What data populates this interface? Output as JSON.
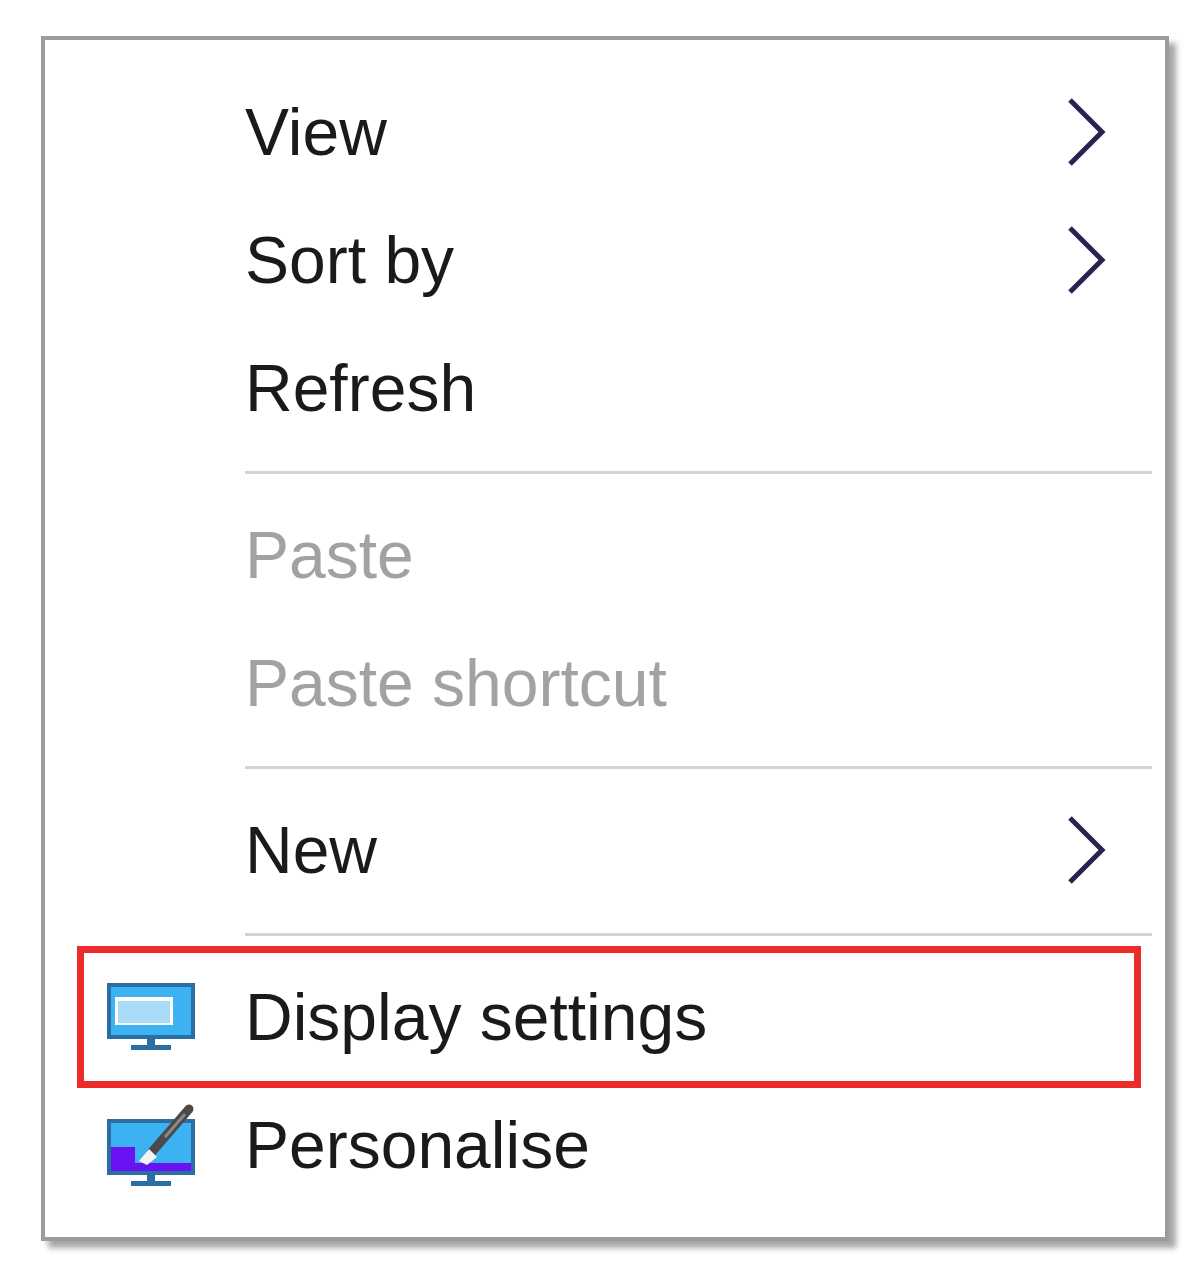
{
  "menu": {
    "items": [
      {
        "kind": "submenu",
        "label": "View",
        "disabled": false,
        "highlighted": false
      },
      {
        "kind": "submenu",
        "label": "Sort by",
        "disabled": false,
        "highlighted": false
      },
      {
        "kind": "command",
        "label": "Refresh",
        "disabled": false,
        "highlighted": false
      },
      {
        "kind": "separator"
      },
      {
        "kind": "command",
        "label": "Paste",
        "disabled": true,
        "highlighted": false
      },
      {
        "kind": "command",
        "label": "Paste shortcut",
        "disabled": true,
        "highlighted": false
      },
      {
        "kind": "separator"
      },
      {
        "kind": "submenu",
        "label": "New",
        "disabled": false,
        "highlighted": false
      },
      {
        "kind": "separator"
      },
      {
        "kind": "command",
        "label": "Display settings",
        "disabled": false,
        "highlighted": true,
        "icon": true
      },
      {
        "kind": "command",
        "label": "Personalise",
        "disabled": false,
        "highlighted": false,
        "icon": true
      }
    ]
  }
}
